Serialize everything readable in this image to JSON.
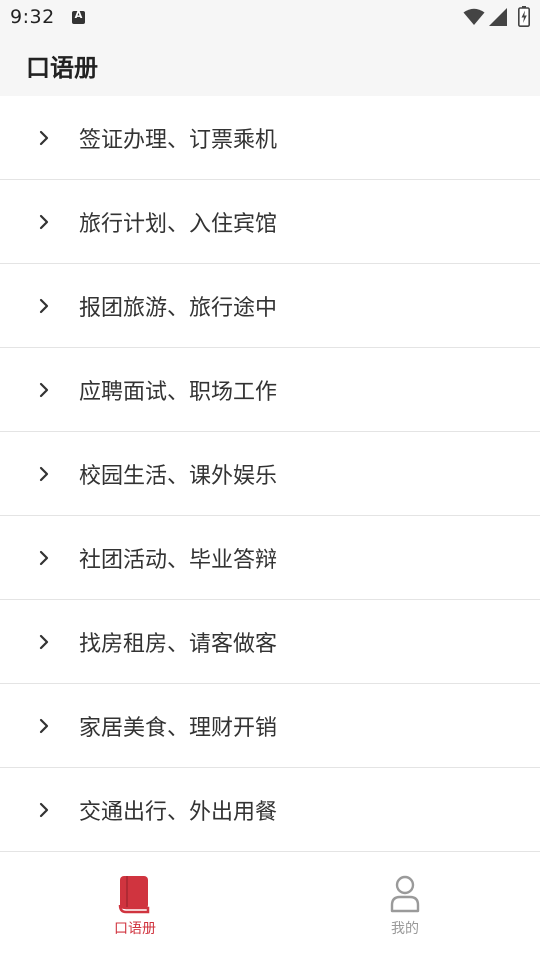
{
  "status_bar": {
    "time": "9:32"
  },
  "header": {
    "title": "口语册"
  },
  "topics": [
    {
      "label": "签证办理、订票乘机"
    },
    {
      "label": "旅行计划、入住宾馆"
    },
    {
      "label": "报团旅游、旅行途中"
    },
    {
      "label": "应聘面试、职场工作"
    },
    {
      "label": "校园生活、课外娱乐"
    },
    {
      "label": "社团活动、毕业答辩"
    },
    {
      "label": "找房租房、请客做客"
    },
    {
      "label": "家居美食、理财开销"
    },
    {
      "label": "交通出行、外出用餐"
    }
  ],
  "bottom_nav": {
    "tabs": [
      {
        "label": "口语册",
        "icon": "book-icon",
        "active": true
      },
      {
        "label": "我的",
        "icon": "person-icon",
        "active": false
      }
    ]
  },
  "colors": {
    "accent": "#d0343f",
    "inactive": "#999999",
    "header_bg": "#f6f6f6"
  }
}
